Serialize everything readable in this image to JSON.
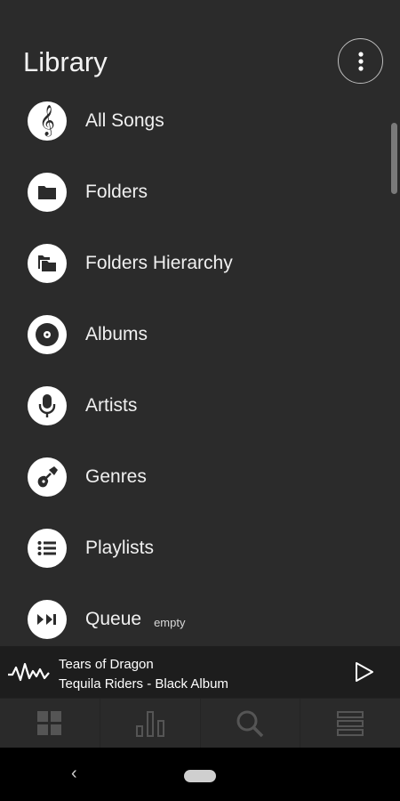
{
  "header": {
    "title": "Library",
    "menu_icon": "more-vertical-icon"
  },
  "library_items": [
    {
      "label": "All Songs",
      "icon": "treble-clef-icon"
    },
    {
      "label": "Folders",
      "icon": "folder-icon"
    },
    {
      "label": "Folders Hierarchy",
      "icon": "folders-hierarchy-icon"
    },
    {
      "label": "Albums",
      "icon": "album-disc-icon"
    },
    {
      "label": "Artists",
      "icon": "microphone-icon"
    },
    {
      "label": "Genres",
      "icon": "guitar-icon"
    },
    {
      "label": "Playlists",
      "icon": "playlist-icon"
    },
    {
      "label": "Queue",
      "icon": "queue-icon",
      "badge": "empty"
    }
  ],
  "now_playing": {
    "title": "Tears of Dragon",
    "subtitle": "Tequila Riders - Black Album",
    "visualizer_icon": "waveform-icon",
    "play_icon": "play-icon"
  },
  "tabs": [
    {
      "name": "tab-library",
      "icon": "grid-icon"
    },
    {
      "name": "tab-stats",
      "icon": "bar-chart-icon"
    },
    {
      "name": "tab-search",
      "icon": "search-icon"
    },
    {
      "name": "tab-queue",
      "icon": "list-icon"
    }
  ],
  "colors": {
    "background": "#2b2b2b",
    "now_playing_bg": "#1d1d1d",
    "tab_icon": "#555555",
    "icon_circle": "#ffffff"
  }
}
